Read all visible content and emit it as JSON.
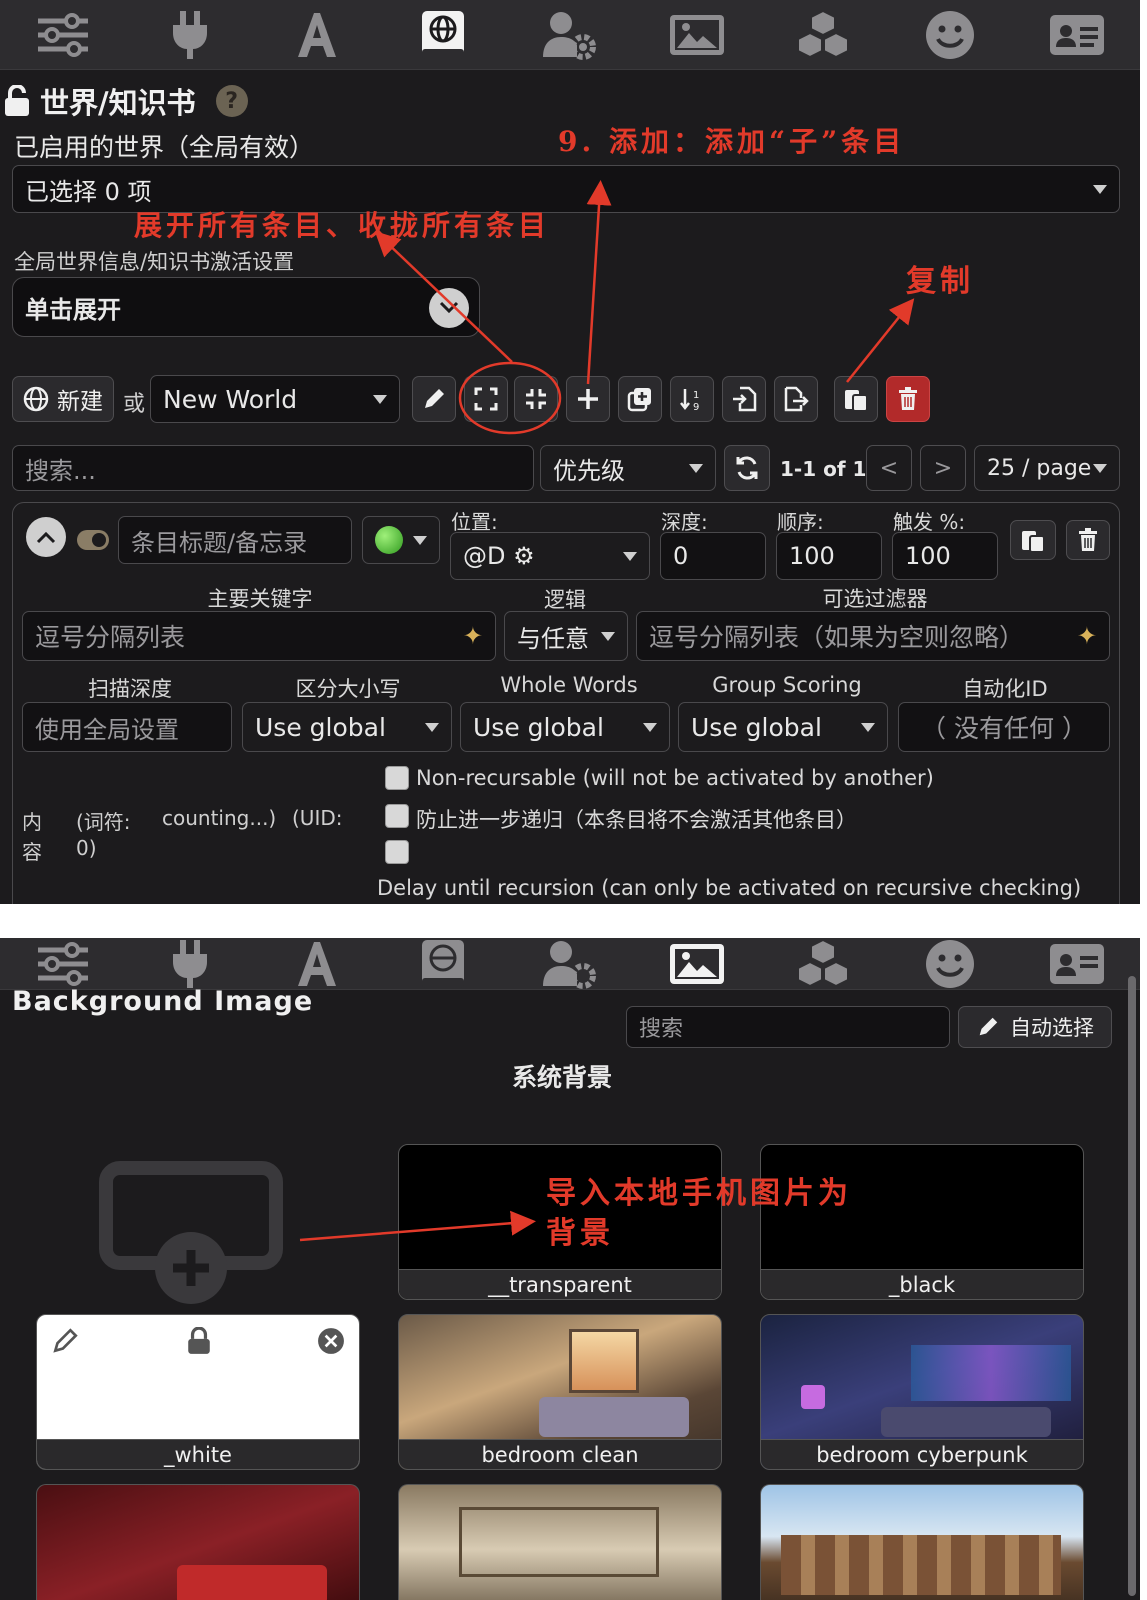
{
  "panel1": {
    "title": "世界/知识书",
    "help": "?",
    "enabled_worlds_label": "已启用的世界（全局有效）",
    "selected_count": "已选择 0 项",
    "activation_label": "全局世界信息/知识书激活设置",
    "expand_label": "单击展开",
    "new_button": "新建",
    "or_label": "或",
    "world_select": "New World",
    "search_placeholder": "搜索...",
    "sort_select": "优先级",
    "pagination": "1-1 of 1",
    "prev": "<",
    "next": ">",
    "page_size": "25 / page",
    "entry": {
      "title_placeholder": "条目标题/备忘录",
      "position_label": "位置:",
      "position_value": "@D ⚙",
      "depth_label": "深度:",
      "depth_value": "0",
      "order_label": "顺序:",
      "order_value": "100",
      "trigger_label": "触发 %:",
      "trigger_value": "100",
      "primary_keys_label": "主要关键字",
      "primary_keys_placeholder": "逗号分隔列表",
      "logic_label": "逻辑",
      "logic_value": "与任意",
      "filter_label": "可选过滤器",
      "filter_placeholder": "逗号分隔列表（如果为空则忽略）",
      "scan_depth_label": "扫描深度",
      "scan_depth_value": "使用全局设置",
      "case_label": "区分大小写",
      "case_value": "Use global",
      "whole_words_label": "Whole Words",
      "whole_words_value": "Use global",
      "group_scoring_label": "Group Scoring",
      "group_scoring_value": "Use global",
      "automation_label": "自动化ID",
      "automation_value": "（ 没有任何 ）",
      "content_label_1": "内",
      "content_label_2": "容",
      "token_info_1": "(词符:",
      "token_info_2": "counting...)",
      "uid_1": "(UID:",
      "uid_2": "0)",
      "opt_non_recursable": "Non-recursable (will not be activated by another)",
      "opt_prevent_recursion": "防止进一步递归（本条目将不会激活其他条目）",
      "opt_delay": "Delay until recursion (can only be activated on recursive checking)"
    },
    "annotations": {
      "add_child": "9. 添加：添加“子”条目",
      "expand_collapse": "展开所有条目、收拢所有条目",
      "copy": "复制"
    }
  },
  "panel2": {
    "title": "Background Image",
    "search_placeholder": "搜索",
    "auto_select": "自动选择",
    "section": "系统背景",
    "annotation_1": "导入本地手机图片为",
    "annotation_2": "背景",
    "cards": [
      "__transparent",
      "_black",
      "_white",
      "bedroom clean",
      "bedroom cyberpunk"
    ]
  },
  "colors": {
    "accent_red": "#e23a2a",
    "panel_bg": "#1c1b1d",
    "toolbar_bg": "#2d2c2f",
    "delete_red": "#b22a2a"
  },
  "icons": [
    "sliders-icon",
    "plug-icon",
    "font-icon",
    "book-globe-icon",
    "user-gear-icon",
    "image-icon",
    "cubes-icon",
    "smile-icon",
    "id-card-icon"
  ]
}
